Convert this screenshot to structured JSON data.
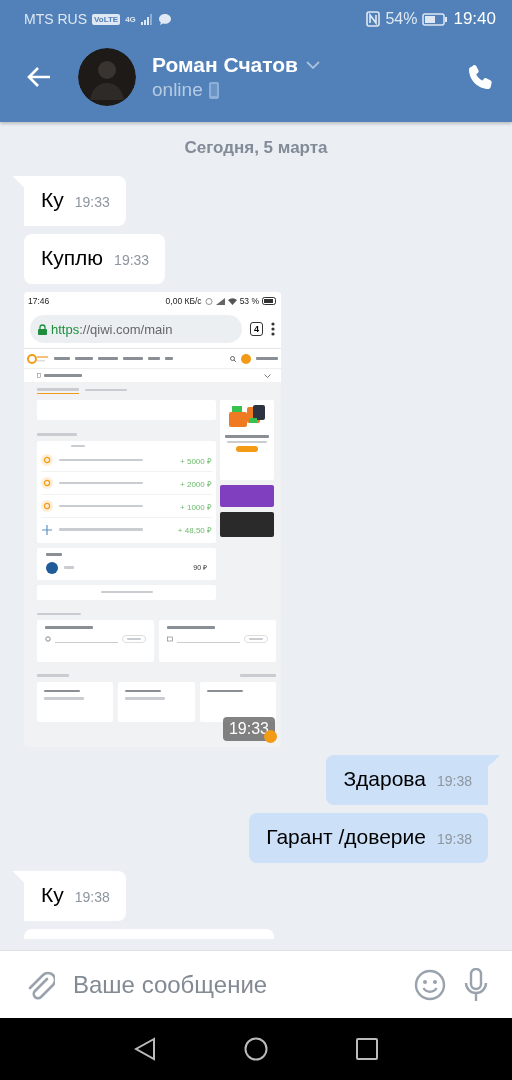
{
  "status_bar": {
    "carrier": "MTS RUS",
    "volte": "VoLTE",
    "network": "4G",
    "battery": "54%",
    "time": "19:40"
  },
  "header": {
    "name": "Роман Счатов",
    "status": "online"
  },
  "date_divider": "Сегодня, 5 марта",
  "messages": [
    {
      "kind": "text",
      "incoming": true,
      "tail": true,
      "text": "Ку",
      "time": "19:33"
    },
    {
      "kind": "text",
      "incoming": true,
      "tail": false,
      "text": "Куплю",
      "time": "19:33"
    },
    {
      "kind": "screenshot",
      "time": "19:33"
    },
    {
      "kind": "text",
      "incoming": false,
      "tail": true,
      "text": "Здарова",
      "time": "19:38"
    },
    {
      "kind": "text",
      "incoming": false,
      "tail": false,
      "text": "Гарант /доверие",
      "time": "19:38"
    },
    {
      "kind": "text",
      "incoming": true,
      "tail": true,
      "text": "Ку",
      "time": "19:38"
    },
    {
      "kind": "partial"
    }
  ],
  "screenshot": {
    "status": {
      "time": "17:46",
      "speed": "0,00 КБ/с",
      "battery": "53 %"
    },
    "url": {
      "scheme": "https",
      "rest": "://qiwi.com/main"
    },
    "tab_count": "4",
    "tabs": [
      {
        "selected": true
      },
      {
        "selected": false
      }
    ],
    "payments": [
      {
        "kind": "qiwi",
        "amount": "+ 5000 ₽"
      },
      {
        "kind": "qiwi",
        "amount": "+ 2000 ₽"
      },
      {
        "kind": "qiwi",
        "amount": "+ 1000 ₽"
      },
      {
        "kind": "plus",
        "amount": "+ 48,50 ₽"
      }
    ],
    "feb_amount": "90 ₽"
  },
  "composer": {
    "placeholder": "Ваше сообщение"
  }
}
